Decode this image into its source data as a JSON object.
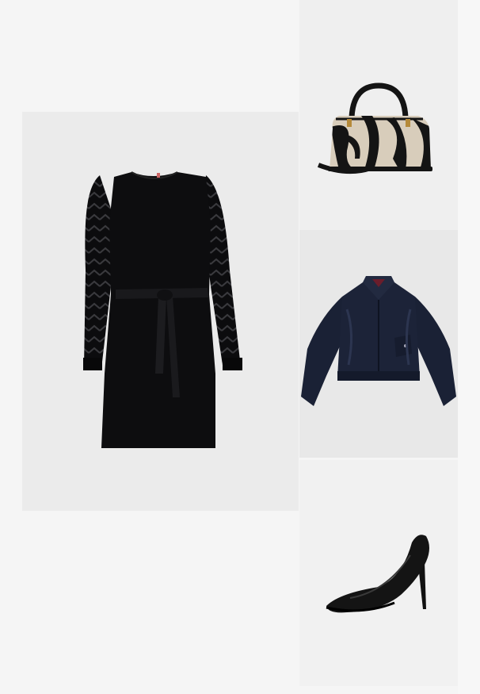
{
  "outfit": {
    "items": [
      {
        "name": "dress",
        "icon": "black-belted-dress-image"
      },
      {
        "name": "bag",
        "icon": "zebra-print-handbag-image"
      },
      {
        "name": "jacket",
        "icon": "navy-bomber-jacket-image"
      },
      {
        "name": "shoe",
        "icon": "black-stiletto-pump-image"
      }
    ]
  },
  "colors": {
    "page_background": "#f5f5f5",
    "tile_background": "#ebebeb",
    "dress": "#0d0d0f",
    "jacket": "#1b2236",
    "bag_light": "#d8cdbb",
    "bag_dark": "#141414",
    "shoe": "#111111"
  }
}
